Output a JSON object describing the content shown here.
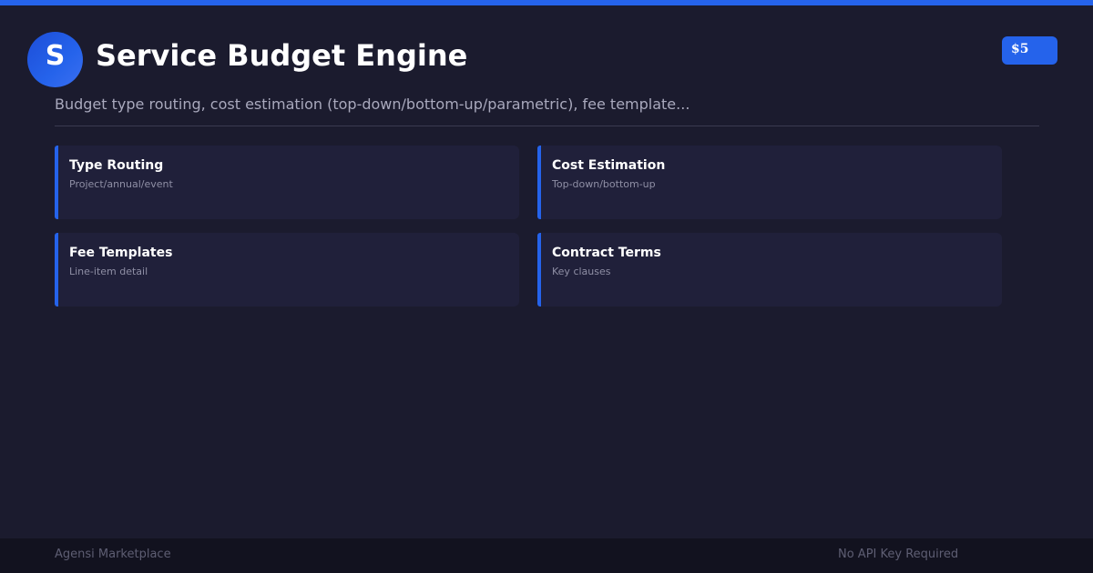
{
  "header": {
    "logo_letter": "S",
    "title": "Service Budget Engine",
    "price": "$5",
    "subtitle": "Budget type routing, cost estimation (top-down/bottom-up/parametric), fee template..."
  },
  "features": [
    {
      "title": "Type Routing",
      "description": "Project/annual/event"
    },
    {
      "title": "Cost Estimation",
      "description": "Top-down/bottom-up"
    },
    {
      "title": "Fee Templates",
      "description": "Line-item detail"
    },
    {
      "title": "Contract Terms",
      "description": "Key clauses"
    }
  ],
  "footer": {
    "brand": "Agensi Marketplace",
    "api_note": "No API Key Required"
  },
  "colors": {
    "accent": "#2563eb",
    "background": "#1b1b2e",
    "card": "#20203a",
    "footer": "#12121f"
  }
}
